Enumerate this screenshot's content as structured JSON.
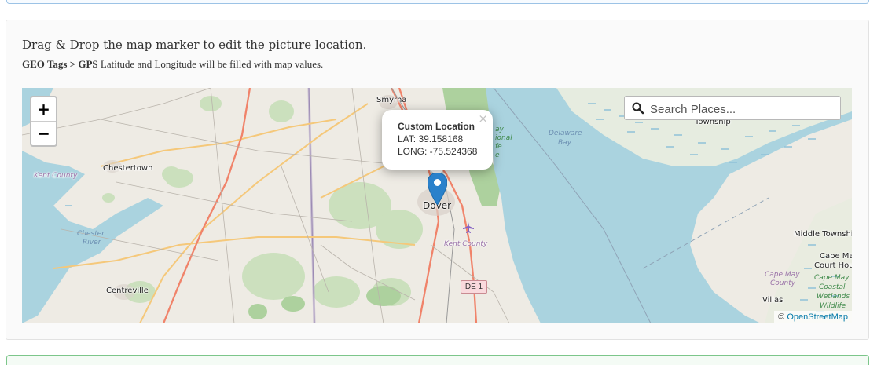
{
  "instructions": {
    "heading": "Drag & Drop the map marker to edit the picture location.",
    "sub_bold": "GEO Tags > GPS",
    "sub_text": "Latitude and Longitude will be filled with map values."
  },
  "map": {
    "zoom_in": "+",
    "zoom_out": "−",
    "search_placeholder": "Search Places...",
    "popup": {
      "title": "Custom Location",
      "lat": "LAT: 39.158168",
      "long": "LONG: -75.524368",
      "close": "×"
    },
    "attribution_prefix": "©",
    "attribution_link": "OpenStreetMap",
    "labels": {
      "smyrna": "Smyrna",
      "township": "Township",
      "chestertown": "Chestertown",
      "kent_county_md": "Kent County",
      "dover": "Dover",
      "delaware": "Delaware",
      "bay": "Bay",
      "chester": "Chester",
      "river": "River",
      "kent_county_de": "Kent County",
      "route_shield": "DE 1",
      "middle_township": "Middle Townshi",
      "cape_may_1": "Cape Ma",
      "court_house": "Court Hou",
      "cape_may_county_1": "Cape May",
      "cape_may_county_2": "County",
      "cape_may_coastal_1": "Cape May",
      "cape_may_coastal_2": "Coastal",
      "cape_may_coastal_3": "Wetlands",
      "cape_may_coastal_4": "Wildlife",
      "centreville": "Centreville",
      "villas": "Villas",
      "refuge_1": "ay",
      "refuge_2": "ional",
      "refuge_3": "fe",
      "refuge_4": "e"
    },
    "colors": {
      "land": "#eeebe4",
      "water": "#aad3df",
      "wetland": "#cbe2c2",
      "forest": "#add19e",
      "primary_road": "#f0836a",
      "secondary_road": "#f5c87a",
      "marker": "#2a81cb"
    },
    "icons": [
      "search-icon",
      "map-marker-icon",
      "airport-icon",
      "close-icon"
    ]
  }
}
